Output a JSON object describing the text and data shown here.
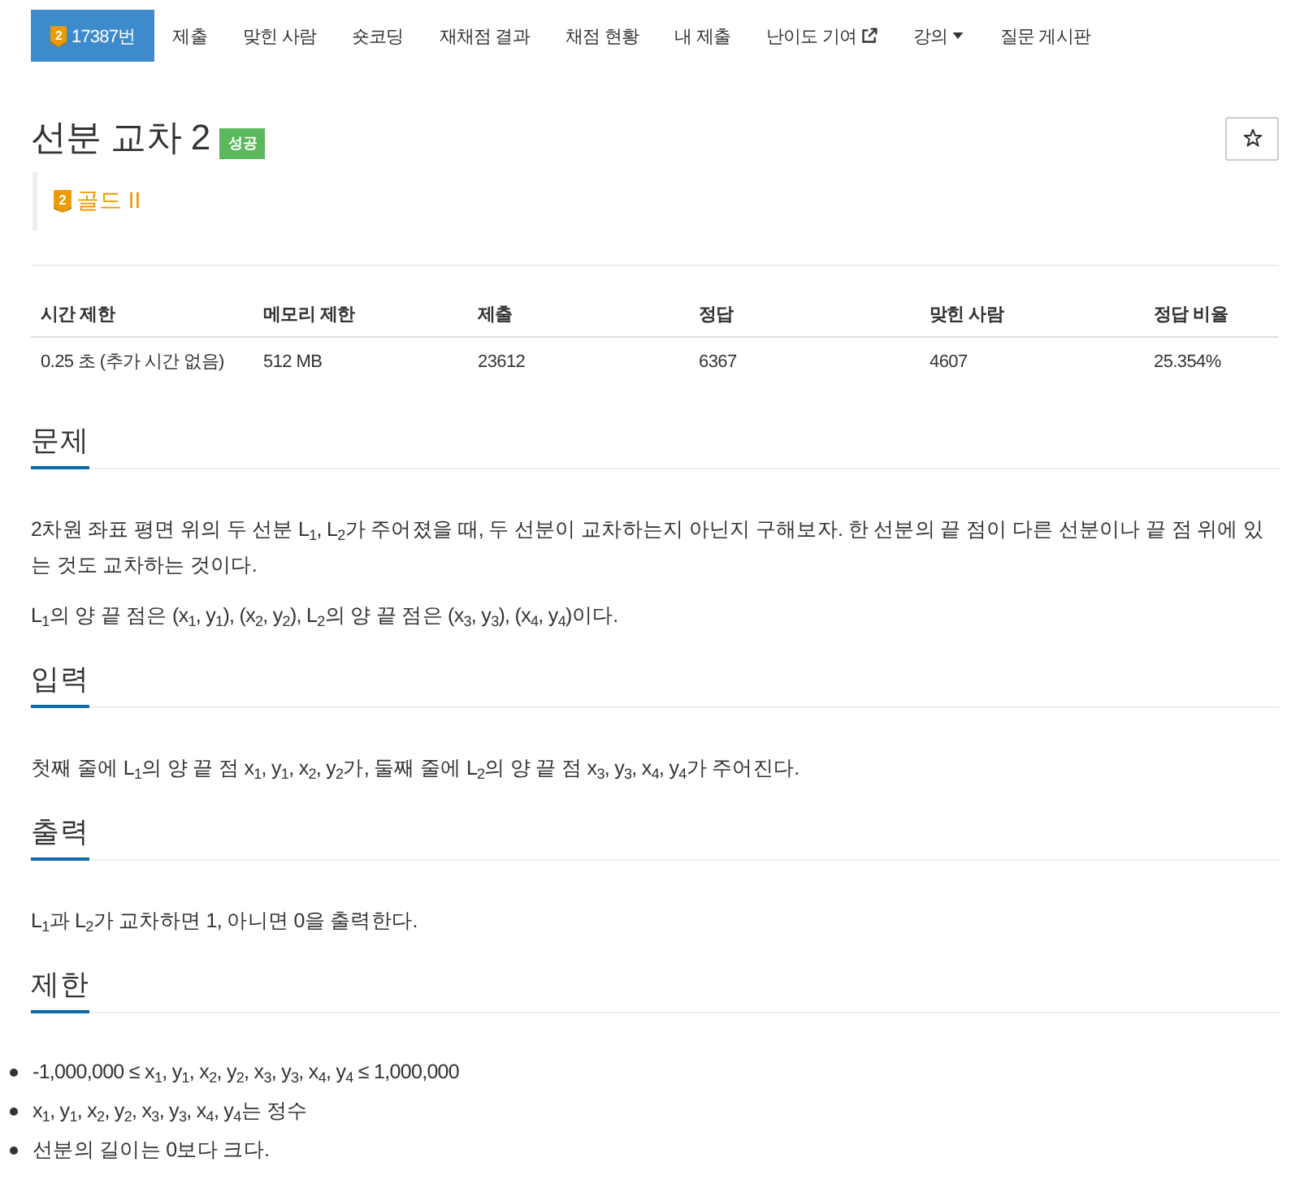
{
  "nav": {
    "items": [
      {
        "label": "17387번",
        "kind": "problem",
        "tier_digit": "2",
        "selected": true
      },
      {
        "label": "제출",
        "kind": "plain",
        "selected": false
      },
      {
        "label": "맞힌 사람",
        "kind": "plain",
        "selected": false
      },
      {
        "label": "숏코딩",
        "kind": "plain",
        "selected": false
      },
      {
        "label": "재채점 결과",
        "kind": "plain",
        "selected": false
      },
      {
        "label": "채점 현황",
        "kind": "plain",
        "selected": false
      },
      {
        "label": "내 제출",
        "kind": "plain",
        "selected": false
      },
      {
        "label": "난이도 기여",
        "kind": "external",
        "selected": false
      },
      {
        "label": "강의",
        "kind": "dropdown",
        "selected": false
      },
      {
        "label": "질문 게시판",
        "kind": "plain",
        "selected": false
      }
    ]
  },
  "title": "선분 교차 2",
  "result_badge": "성공",
  "tier": {
    "digit": "2",
    "label": "골드 II"
  },
  "table": {
    "columns": [
      "시간 제한",
      "메모리 제한",
      "제출",
      "정답",
      "맞힌 사람",
      "정답 비율"
    ],
    "rows": [
      [
        "0.25 초 (추가 시간 없음)",
        "512 MB",
        "23612",
        "6367",
        "4607",
        "25.354%"
      ]
    ]
  },
  "sections": [
    {
      "heading": "문제",
      "kind": "paragraphs",
      "paragraphs": [
        "2차원 좌표 평면 위의 두 선분 L$_{1}$, L$_{2}$가 주어졌을 때, 두 선분이 교차하는지 아닌지 구해보자. 한 선분의 끝 점이 다른 선분이나 끝 점 위에 있는 것도 교차하는 것이다.",
        "L$_{1}$의 양 끝 점은 (x$_{1}$, y$_{1}$), (x$_{2}$, y$_{2}$), L$_{2}$의 양 끝 점은 (x$_{3}$, y$_{3}$), (x$_{4}$, y$_{4}$)이다."
      ]
    },
    {
      "heading": "입력",
      "kind": "paragraphs",
      "paragraphs": [
        "첫째 줄에 L$_{1}$의 양 끝 점 x$_{1}$, y$_{1}$, x$_{2}$, y$_{2}$가, 둘째 줄에 L$_{2}$의 양 끝 점 x$_{3}$, y$_{3}$, x$_{4}$, y$_{4}$가 주어진다."
      ]
    },
    {
      "heading": "출력",
      "kind": "paragraphs",
      "paragraphs": [
        "L$_{1}$과 L$_{2}$가 교차하면 1, 아니면 0을 출력한다."
      ]
    },
    {
      "heading": "제한",
      "kind": "bullets",
      "items": [
        "-1,000,000 ≤ x$_{1}$, y$_{1}$, x$_{2}$, y$_{2}$, x$_{3}$, y$_{3}$, x$_{4}$, y$_{4}$ ≤ 1,000,000",
        "x$_{1}$, y$_{1}$, x$_{2}$, y$_{2}$, x$_{3}$, y$_{3}$, x$_{4}$, y$_{4}$는 정수",
        "선분의 길이는 0보다 크다."
      ]
    }
  ]
}
